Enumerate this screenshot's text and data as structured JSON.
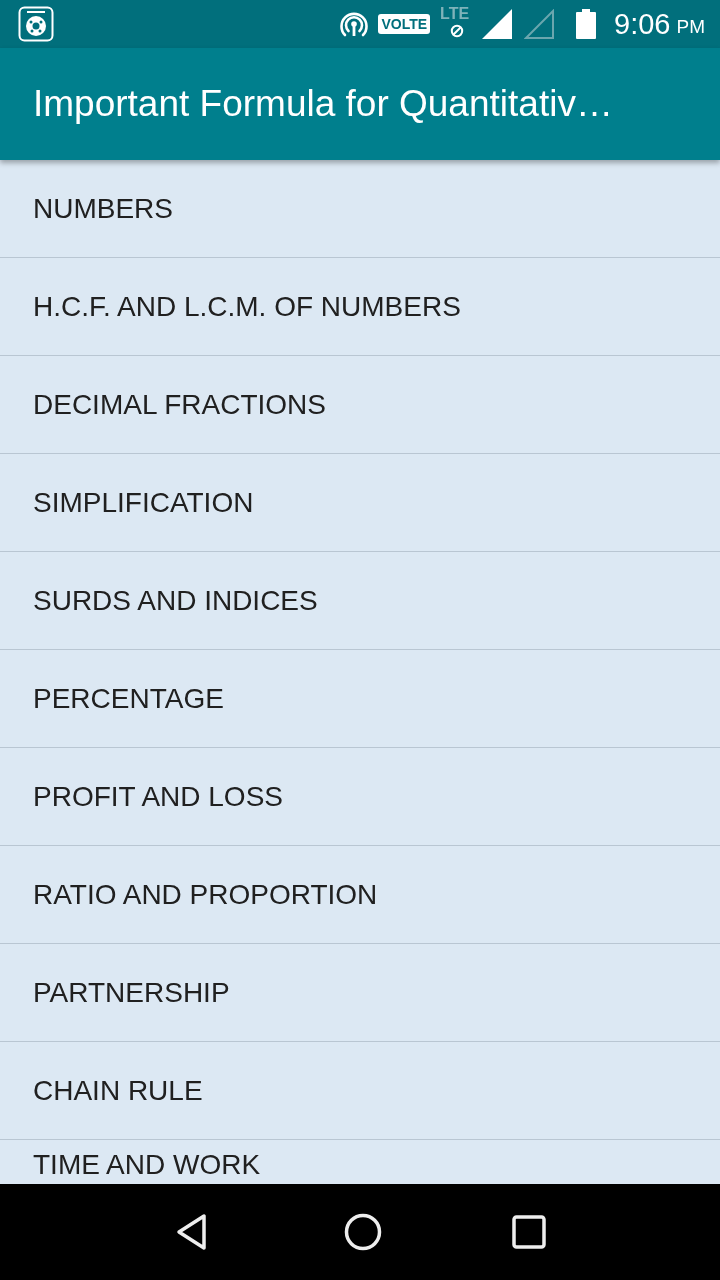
{
  "status_bar": {
    "volte": "VOLTE",
    "network": "LTE",
    "time": "9:06",
    "time_suffix": "PM"
  },
  "app_bar": {
    "title": "Important Formula for Quantitativ…"
  },
  "topics": [
    "NUMBERS",
    "H.C.F. AND L.C.M. OF NUMBERS",
    "DECIMAL FRACTIONS",
    "SIMPLIFICATION",
    "SURDS AND INDICES",
    "PERCENTAGE",
    "PROFIT AND LOSS",
    "RATIO AND PROPORTION",
    "PARTNERSHIP",
    "CHAIN RULE",
    "TIME AND WORK"
  ]
}
